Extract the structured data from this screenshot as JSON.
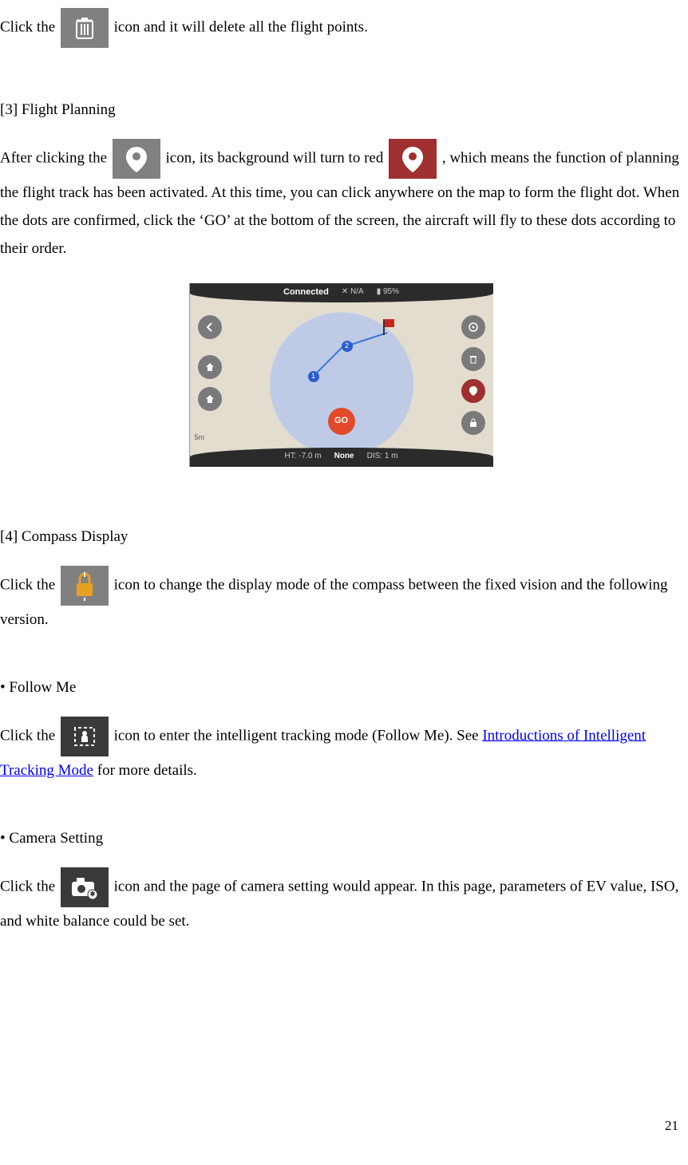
{
  "p1": {
    "a": "Click the ",
    "b": " icon and it will delete all the flight points."
  },
  "s3": {
    "title": "[3] Flight Planning",
    "a": "After clicking the ",
    "b": " icon, its background will turn to red ",
    "c": ", which means the function of planning the flight track has been activated. At this time, you can click anywhere on the map to form the flight dot. When the dots are confirmed, click the ‘GO’ at the bottom of the screen, the aircraft will fly to these dots according to their order."
  },
  "fig": {
    "connected": "Connected",
    "na": "N/A",
    "batt": "95%",
    "go": "GO",
    "ht": "HT: -7.0 m",
    "none": "None",
    "dis": "DIS: 1 m",
    "scale": "5m",
    "wp1": "1",
    "wp2": "2"
  },
  "s4": {
    "title": "[4] Compass Display",
    "a": "Click the ",
    "b": " icon to change the display mode of the compass between the fixed vision and the following version."
  },
  "fm": {
    "title": "• Follow Me",
    "a": "Click the ",
    "b": " icon to enter the intelligent tracking mode (Follow Me). See ",
    "link": "Introductions of Intelligent Tracking Mode",
    "c": " for more details."
  },
  "cs": {
    "title": "• Camera Setting",
    "a": "Click the ",
    "b": " icon and the page of camera setting would appear. In this page, parameters of EV value, ISO, and white balance could be set."
  },
  "page_number": "21"
}
